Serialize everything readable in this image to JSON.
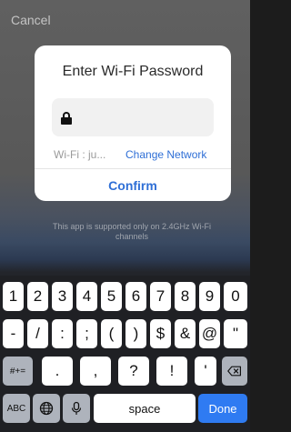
{
  "header": {
    "cancel_label": "Cancel"
  },
  "dialog": {
    "title": "Enter Wi-Fi Password",
    "password_value": "",
    "wifi_label": "Wi-Fi : ju...",
    "change_network_label": "Change Network",
    "confirm_label": "Confirm"
  },
  "notice": "This app is supported only on 2.4GHz Wi-Fi channels",
  "keyboard": {
    "row1": [
      "1",
      "2",
      "3",
      "4",
      "5",
      "6",
      "7",
      "8",
      "9",
      "0"
    ],
    "row2": [
      "-",
      "/",
      ":",
      ";",
      "(",
      ")",
      "$",
      "&",
      "@",
      "\""
    ],
    "row3_mode": "#+=",
    "row3": [
      ".",
      ",",
      "?",
      "!",
      "'"
    ],
    "row4_abc": "ABC",
    "row4_space": "space",
    "row4_done": "Done",
    "icons": [
      "backspace-icon",
      "globe-icon",
      "mic-icon"
    ]
  },
  "colors": {
    "accent": "#2f6fd6",
    "done_key": "#2f7bf2"
  }
}
